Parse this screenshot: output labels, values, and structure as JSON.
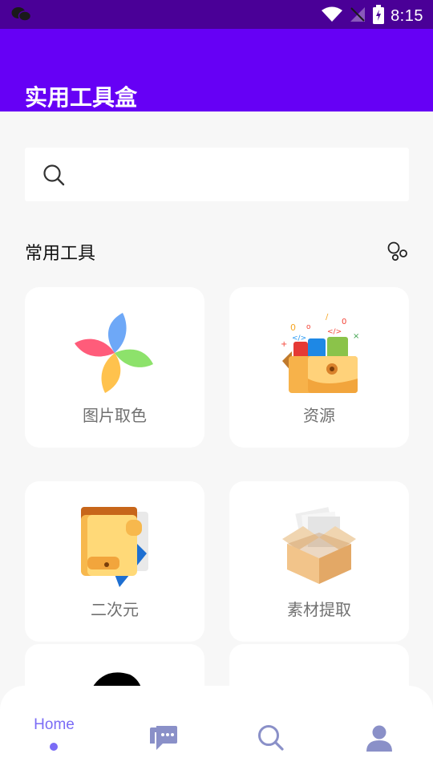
{
  "status_bar": {
    "time": "8:15"
  },
  "app_bar": {
    "title": "实用工具盒"
  },
  "search": {
    "placeholder": ""
  },
  "section": {
    "title": "常用工具"
  },
  "tools": [
    {
      "label": "图片取色",
      "icon": "pinwheel-icon"
    },
    {
      "label": "资源",
      "icon": "code-box-icon"
    },
    {
      "label": "二次元",
      "icon": "wallet-icon"
    },
    {
      "label": "素材提取",
      "icon": "open-box-icon"
    },
    {
      "label": "",
      "icon": "black-shape-icon"
    },
    {
      "label": "",
      "icon": "confetti-icon"
    }
  ],
  "bottom_nav": {
    "items": [
      {
        "label": "Home",
        "icon": "home",
        "active": true
      },
      {
        "label": "",
        "icon": "chat-bubbles-icon"
      },
      {
        "label": "",
        "icon": "search-icon"
      },
      {
        "label": "",
        "icon": "person-icon"
      }
    ]
  },
  "colors": {
    "status_bar": "#4a0097",
    "app_bar": "#6600f5",
    "accent": "#7b6cf6",
    "nav_icon": "#8a90c8"
  }
}
